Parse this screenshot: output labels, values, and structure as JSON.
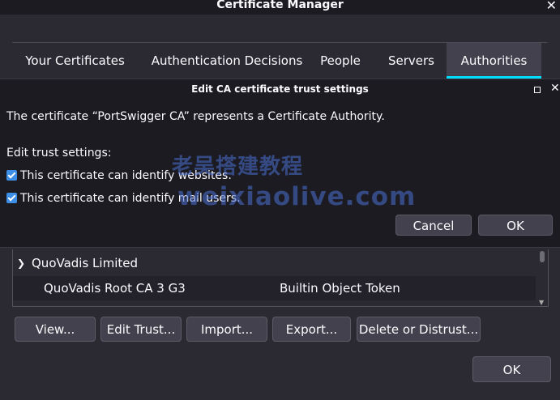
{
  "window": {
    "title": "Certificate Manager"
  },
  "tabs": [
    {
      "label": "Your Certificates",
      "selected": false
    },
    {
      "label": "Authentication Decisions",
      "selected": false
    },
    {
      "label": "People",
      "selected": false
    },
    {
      "label": "Servers",
      "selected": false
    },
    {
      "label": "Authorities",
      "selected": true
    }
  ],
  "tree": {
    "group": "QuoVadis Limited",
    "rows": [
      {
        "name": "QuoVadis Root CA 3 G3",
        "token": "Builtin Object Token"
      }
    ]
  },
  "actions": {
    "view": "View...",
    "edit_trust": "Edit Trust...",
    "import": "Import...",
    "export": "Export...",
    "delete": "Delete or Distrust..."
  },
  "main_ok": "OK",
  "dialog": {
    "title": "Edit CA certificate trust settings",
    "message": "The certificate “PortSwigger CA” represents a Certificate Authority.",
    "settings_label": "Edit trust settings:",
    "checkboxes": [
      {
        "label": "This certificate can identify websites.",
        "checked": true
      },
      {
        "label": "This certificate can identify mail users.",
        "checked": true
      }
    ],
    "cancel": "Cancel",
    "ok": "OK"
  },
  "watermark": {
    "line1": "老吴搭建教程",
    "line2": "weixiaolive.com"
  },
  "colors": {
    "accent": "#00ddff",
    "checkbox": "#3d8ee6",
    "background": "#1c1b22"
  }
}
